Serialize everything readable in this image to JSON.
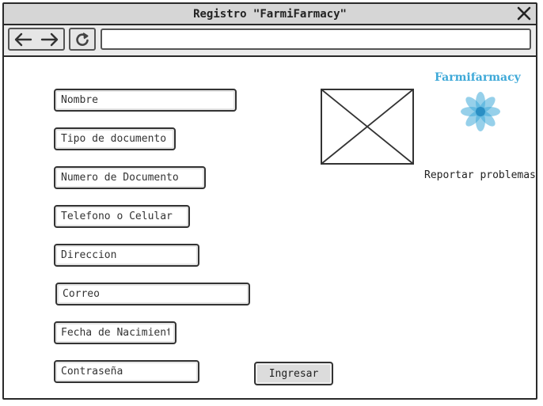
{
  "window": {
    "title": "Registro \"FarmiFarmacy\"",
    "close_label": "✕"
  },
  "toolbar": {
    "back_icon": "arrow-left-icon",
    "forward_icon": "arrow-right-icon",
    "reload_icon": "reload-icon",
    "url_value": ""
  },
  "form": {
    "fields": [
      {
        "placeholder": "Nombre"
      },
      {
        "placeholder": "Tipo de documento"
      },
      {
        "placeholder": "Numero de Documento"
      },
      {
        "placeholder": "Telefono o Celular"
      },
      {
        "placeholder": "Direccion"
      },
      {
        "placeholder": "Correo"
      },
      {
        "placeholder": "Fecha de Nacimiento"
      },
      {
        "placeholder": "Contraseña"
      }
    ],
    "submit_label": "Ingresar"
  },
  "brand": {
    "name": "Farmifarmacy",
    "color": "#3fa9d8",
    "logo_icon": "flower-logo-icon"
  },
  "side": {
    "report_link": "Reportar problemas",
    "image_placeholder_icon": "image-placeholder-icon"
  }
}
